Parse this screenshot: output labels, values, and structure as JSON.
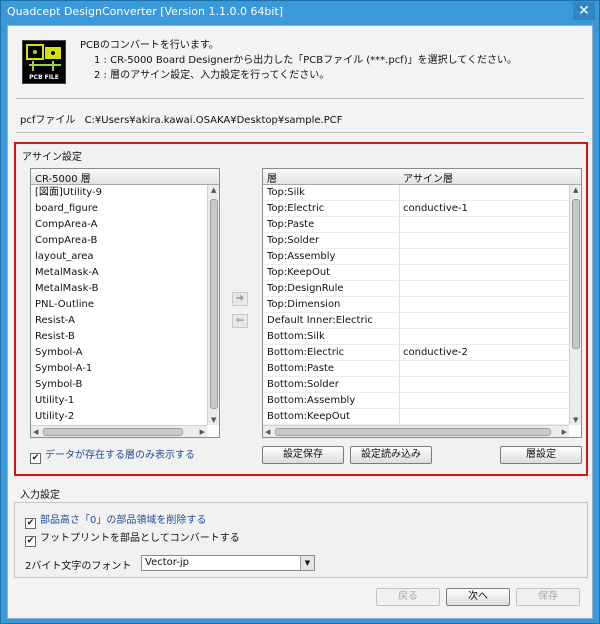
{
  "window": {
    "title": "Quadcept DesignConverter [Version 1.1.0.0 64bit]",
    "close": "✕"
  },
  "logo": {
    "label": "PCB FILE"
  },
  "intro": {
    "line1": "PCBのコンバートを行います。",
    "line2": "1 : CR-5000 Board Designerから出力した「PCBファイル (***.pcf)」を選択してください。",
    "line3": "2 : 層のアサイン設定、入力設定を行ってください。"
  },
  "pcf": {
    "label": "pcfファイル",
    "path": "C:¥Users¥akira.kawai.OSAKA¥Desktop¥sample.PCF"
  },
  "assign": {
    "title": "アサイン設定",
    "left_header": "CR-5000 層",
    "left_items": [
      "[図面]Utility-9",
      "board_figure",
      "CompArea-A",
      "CompArea-B",
      "layout_area",
      "MetalMask-A",
      "MetalMask-B",
      "PNL-Outline",
      "Resist-A",
      "Resist-B",
      "Symbol-A",
      "Symbol-A-1",
      "Symbol-B",
      "Utility-1",
      "Utility-2"
    ],
    "right_headers": {
      "layer": "層",
      "assign": "アサイン層"
    },
    "right_rows": [
      {
        "layer": "Top:Silk",
        "assign": ""
      },
      {
        "layer": "Top:Electric",
        "assign": "conductive-1"
      },
      {
        "layer": "Top:Paste",
        "assign": ""
      },
      {
        "layer": "Top:Solder",
        "assign": ""
      },
      {
        "layer": "Top:Assembly",
        "assign": ""
      },
      {
        "layer": "Top:KeepOut",
        "assign": ""
      },
      {
        "layer": "Top:DesignRule",
        "assign": ""
      },
      {
        "layer": "Top:Dimension",
        "assign": ""
      },
      {
        "layer": "Default Inner:Electric",
        "assign": ""
      },
      {
        "layer": "Bottom:Silk",
        "assign": ""
      },
      {
        "layer": "Bottom:Electric",
        "assign": "conductive-2"
      },
      {
        "layer": "Bottom:Paste",
        "assign": ""
      },
      {
        "layer": "Bottom:Solder",
        "assign": ""
      },
      {
        "layer": "Bottom:Assembly",
        "assign": ""
      },
      {
        "layer": "Bottom:KeepOut",
        "assign": ""
      }
    ],
    "move_right": "➜",
    "move_left": "⇐",
    "show_data_only": "データが存在する層のみ表示する",
    "save_settings": "設定保存",
    "load_settings": "設定読み込み",
    "layer_settings": "層設定"
  },
  "input": {
    "title": "入力設定",
    "delete_zero_height": "部品高さ「0」の部品領域を削除する",
    "convert_footprint": "フットプリントを部品としてコンバートする",
    "font_label": "2バイト文字のフォント",
    "font_value": "Vector-jp"
  },
  "nav": {
    "back": "戻る",
    "next": "次へ",
    "save": "保存"
  },
  "colors": {
    "highlight_border": "#d41414",
    "titlebar": "#3a9ad9",
    "link_text": "#1f4e99"
  }
}
